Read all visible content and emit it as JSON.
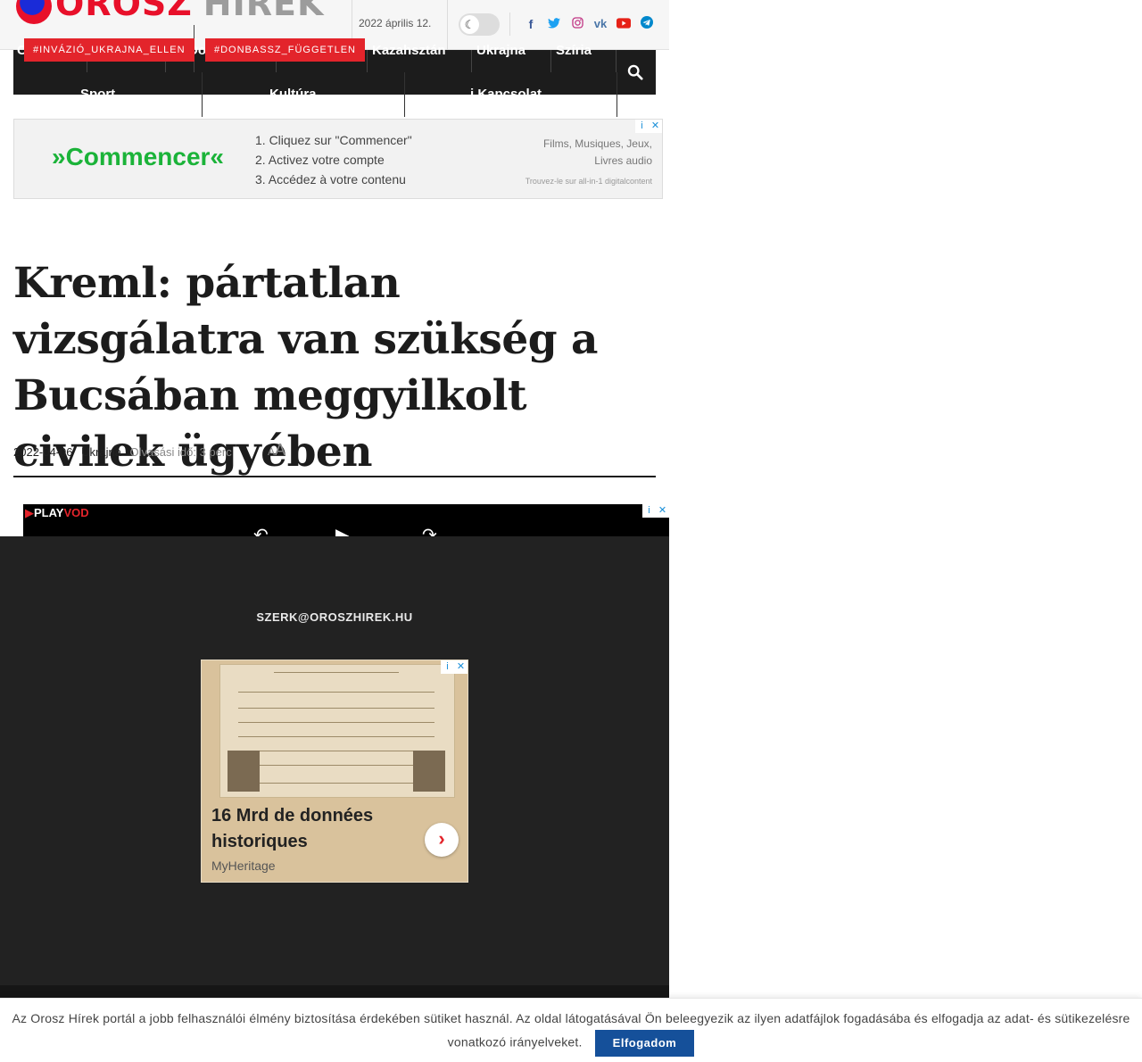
{
  "site": {
    "logo_part1": "OROSZ",
    "logo_part2": "HÍREK",
    "date": "2022 április 12.",
    "theme_toggle_icon": "moon-icon",
    "social": [
      {
        "name": "facebook-icon",
        "glyph": "f",
        "color": "#3b5998"
      },
      {
        "name": "twitter-icon",
        "glyph": "t",
        "color": "#1da1f2"
      },
      {
        "name": "instagram-icon",
        "glyph": "◎",
        "color": "#c13584"
      },
      {
        "name": "vk-icon",
        "glyph": "vk",
        "color": "#4a76a8"
      },
      {
        "name": "youtube-icon",
        "glyph": "▶",
        "color": "#e62117"
      },
      {
        "name": "telegram-icon",
        "glyph": "➤",
        "color": "#0088cc"
      }
    ]
  },
  "nav": {
    "row1": [
      "C",
      "Do",
      "Kazahsztán",
      "Ukrajna",
      "Szíria"
    ],
    "row2": [
      "Sport",
      "Kultúra",
      "Kapcsolat"
    ],
    "contact_icon": "info-icon",
    "search_icon": "search-icon"
  },
  "tags": [
    "#INVÁZIÓ_UKRAJNA_ELLEN",
    "#DONBASSZ_FÜGGETLEN"
  ],
  "ad_banner": {
    "logo": "»Commencer«",
    "steps": [
      "1. Cliquez sur \"Commencer\"",
      "2. Activez votre compte",
      "3. Accédez à votre contenu"
    ],
    "right_line1": "Films, Musiques, Jeux,",
    "right_line2": "Livres audio",
    "small": "Trouvez-le sur all-in-1 digitalcontent",
    "info_glyph": "i",
    "close_glyph": "✕"
  },
  "article": {
    "title": "Kreml: pártatlan vizsgálatra van szükség a Bucsában meggyilkolt civilek ügyében",
    "date": "2022-04-06",
    "category": "Ukrajna",
    "reading_time": "Olvasási idő: 3 perc",
    "font_small": "A",
    "font_large": "A"
  },
  "video_ad": {
    "brand_play": "PLAY",
    "brand_vod": "VOD"
  },
  "footer": {
    "email": "SZERK@OROSZHIREK.HU",
    "ad": {
      "title": "16 Mrd de données historiques",
      "brand": "MyHeritage"
    }
  },
  "cookie": {
    "text": "Az Orosz Hírek portál a jobb felhasználói élmény biztosítása érdekében sütiket használ. Az oldal látogatásával Ön beleegyezik az ilyen adatfájlok fogadásába és elfogadja az adat- és sütikezelésre vonatkozó irányelveket.",
    "button": "Elfogadom"
  }
}
